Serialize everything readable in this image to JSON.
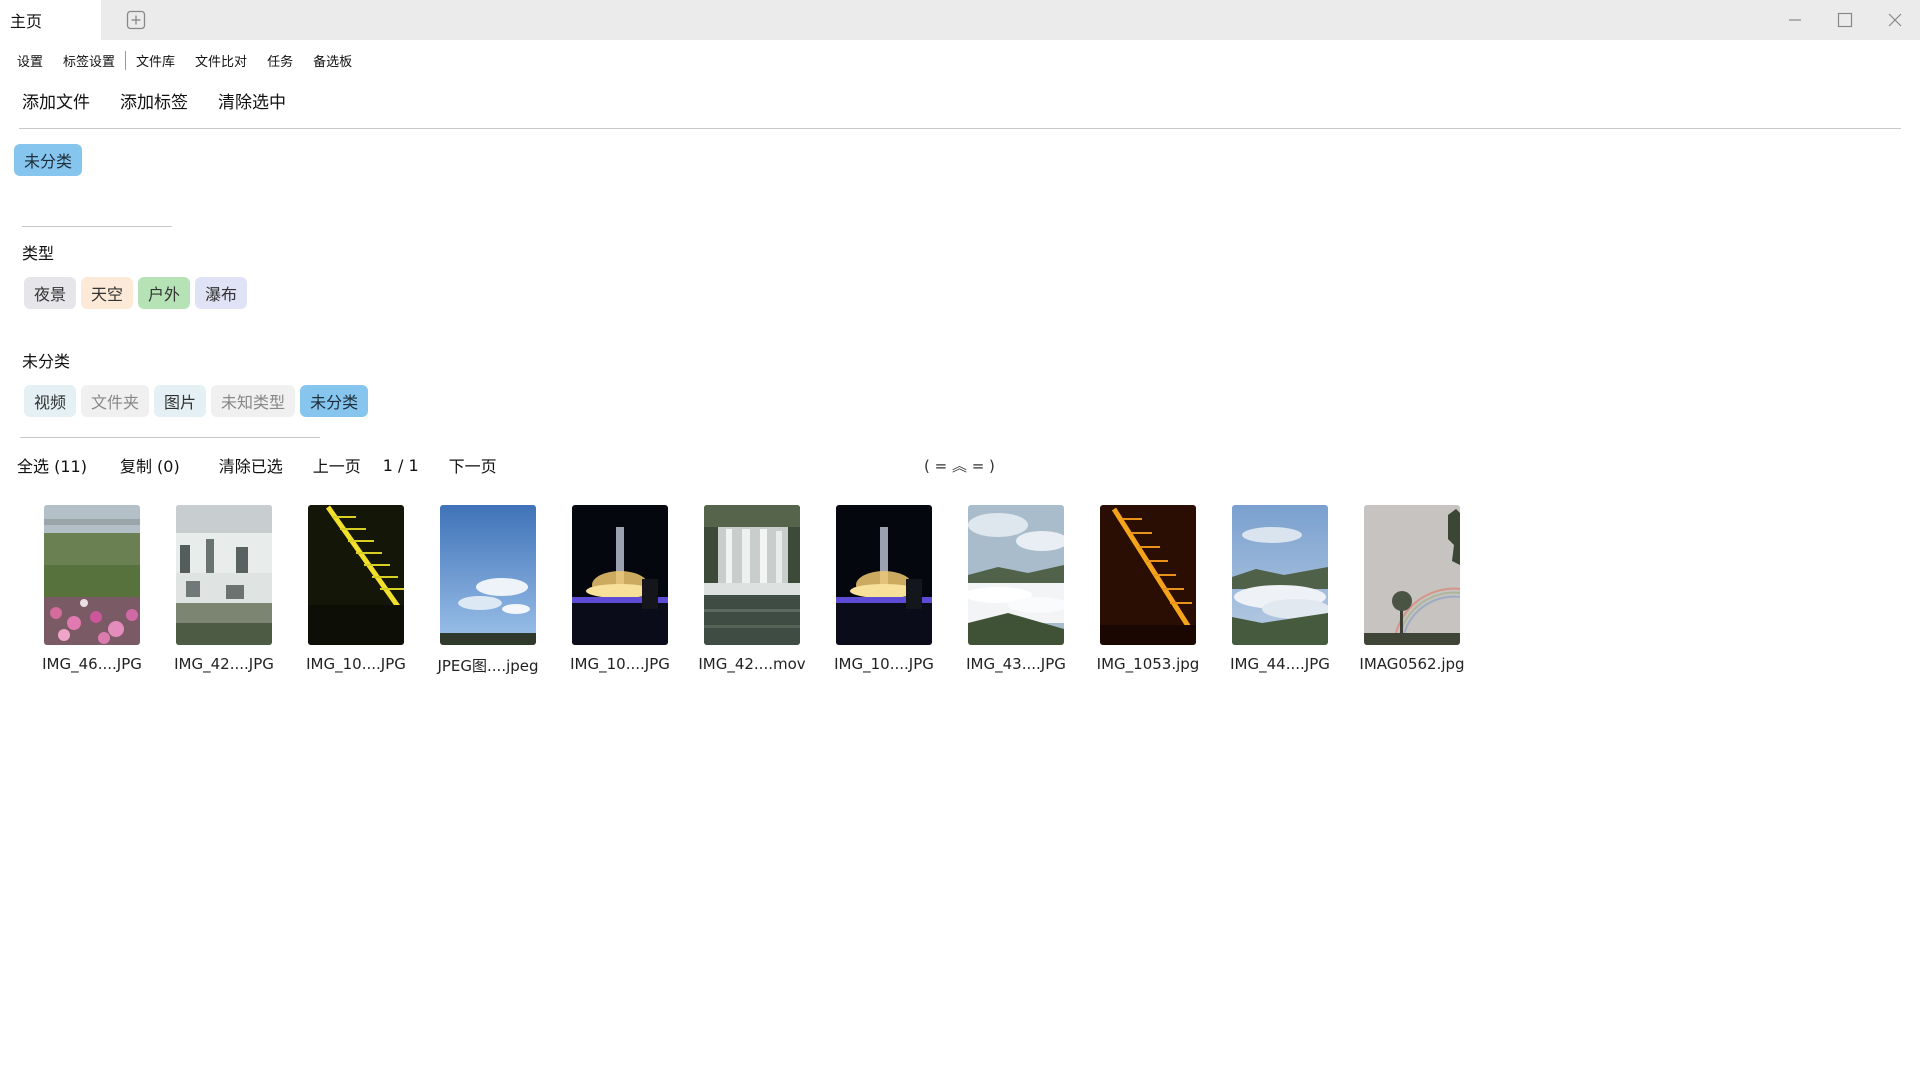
{
  "window": {
    "tab_title": "主页",
    "icons": [
      "new-tab-icon",
      "minimize-icon",
      "maximize-icon",
      "close-icon"
    ]
  },
  "menu": {
    "items": [
      "设置",
      "标签设置",
      "文件库",
      "文件比对",
      "任务",
      "备选板"
    ]
  },
  "toolbar": {
    "add_file": "添加文件",
    "add_tag": "添加标签",
    "clear_selected": "清除选中"
  },
  "selected_filter": "未分类",
  "groups": [
    {
      "title": "类型",
      "tags": [
        {
          "label": "夜景",
          "color": "#e6e6ea"
        },
        {
          "label": "天空",
          "color": "#fde9d8"
        },
        {
          "label": "户外",
          "color": "#b5e3b6"
        },
        {
          "label": "瀑布",
          "color": "#e0e2f6"
        }
      ]
    },
    {
      "title": "未分类",
      "tags": [
        {
          "label": "视频",
          "color": "#e4f0f4"
        },
        {
          "label": "文件夹",
          "color": "#f0f0f0"
        },
        {
          "label": "图片",
          "color": "#e4f0f4"
        },
        {
          "label": "未知类型",
          "color": "#f0f0f0"
        },
        {
          "label": "未分类",
          "color": "#86c5ee"
        }
      ]
    }
  ],
  "actions": {
    "select_all": "全选 (11)",
    "copy": "复制 (0)",
    "clear_picked": "清除已选",
    "prev_page": "上一页",
    "page": "1 / 1",
    "next_page": "下一页",
    "sort_toggle": "( = ︽ = )"
  },
  "files": [
    {
      "name": "IMG_46....JPG",
      "scene": "garden"
    },
    {
      "name": "IMG_42....JPG",
      "scene": "waterfall-white"
    },
    {
      "name": "IMG_10....JPG",
      "scene": "night-steps"
    },
    {
      "name": "JPEG图....jpeg",
      "scene": "blue-sky"
    },
    {
      "name": "IMG_10....JPG",
      "scene": "night-fountain"
    },
    {
      "name": "IMG_42....mov",
      "scene": "waterfall-wide"
    },
    {
      "name": "IMG_10....JPG",
      "scene": "night-fountain"
    },
    {
      "name": "IMG_43....JPG",
      "scene": "sea-of-clouds"
    },
    {
      "name": "IMG_1053.jpg",
      "scene": "night-steps-orange"
    },
    {
      "name": "IMG_44....JPG",
      "scene": "cloud-mountain"
    },
    {
      "name": "IMAG0562.jpg",
      "scene": "rainbow"
    }
  ]
}
